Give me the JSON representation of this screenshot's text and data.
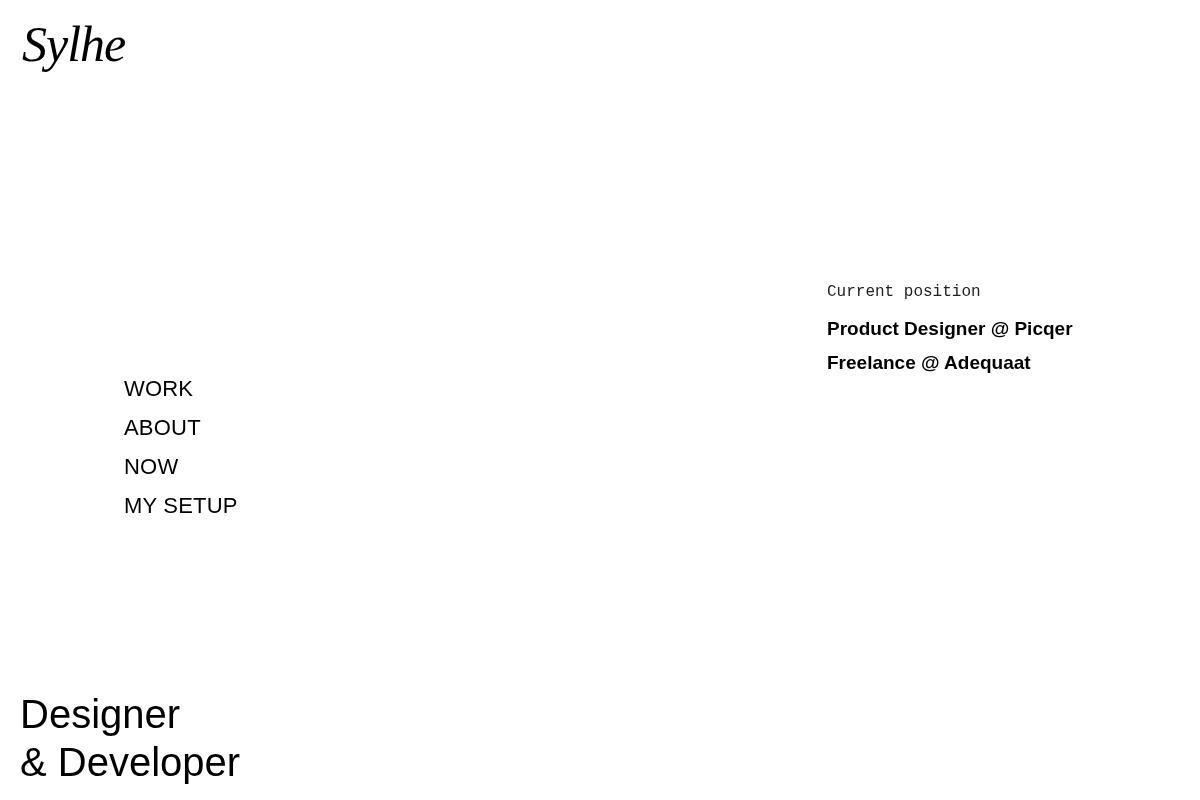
{
  "logo": {
    "text": "Sylhe"
  },
  "current_position": {
    "label": "Current position",
    "roles": [
      "Product Designer @ Picqer",
      "Freelance @ Adequaat"
    ]
  },
  "nav": {
    "items": [
      {
        "label": "WORK"
      },
      {
        "label": "ABOUT"
      },
      {
        "label": "NOW"
      },
      {
        "label": "MY SETUP"
      }
    ]
  },
  "headline": {
    "lines": [
      "Designer",
      "& Developer"
    ]
  }
}
